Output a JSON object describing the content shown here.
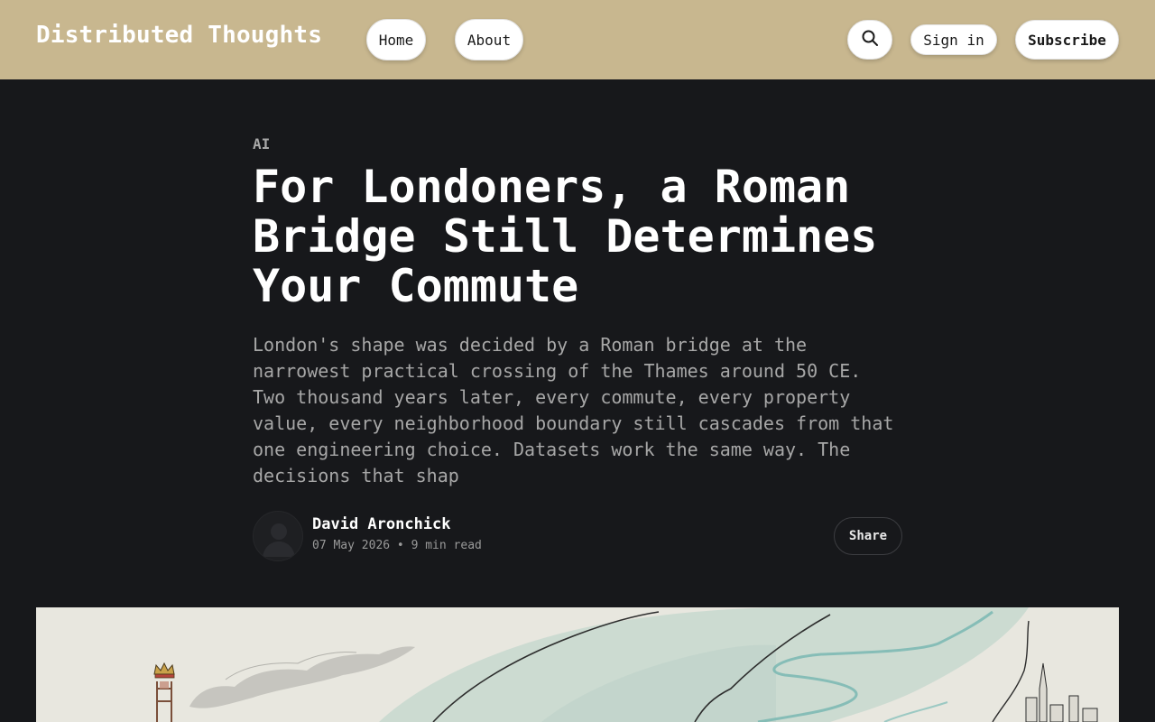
{
  "header": {
    "site_title": "Distributed Thoughts",
    "nav": [
      {
        "label": "Home"
      },
      {
        "label": "About"
      }
    ],
    "search_icon": "search-icon",
    "sign_in_label": "Sign in",
    "subscribe_label": "Subscribe",
    "background_color": "#c8b78f"
  },
  "article": {
    "tag": "AI",
    "title": "For Londoners, a Roman Bridge Still Determines Your Commute",
    "excerpt": "London's shape was decided by a Roman bridge at the narrowest practical crossing of the Thames around 50 CE. Two thousand years later, every commute, every property value, every neighborhood boundary still cascades from that one engineering choice. Datasets work the same way. The decisions that shap",
    "author": {
      "name": "David Aronchick",
      "avatar_icon": "user-avatar-icon"
    },
    "date": "07 May 2026",
    "separator": "•",
    "read_time": "9 min read",
    "share_label": "Share",
    "background_color": "#17181b"
  }
}
